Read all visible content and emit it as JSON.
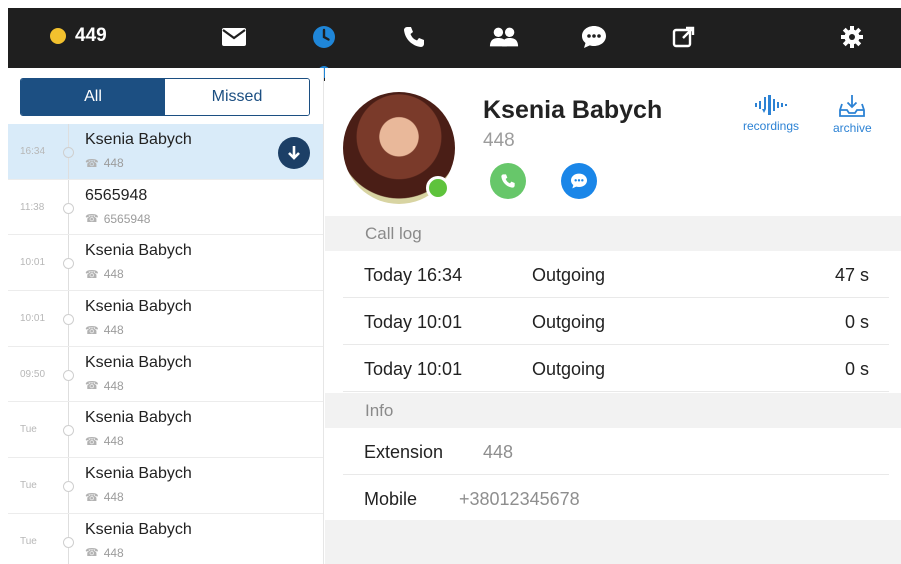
{
  "topbar": {
    "status_count": "449",
    "status_color": "#f2c12e",
    "icons": [
      "envelope-icon",
      "clock-icon",
      "phone-icon",
      "users-icon",
      "chat-icon",
      "external-link-icon",
      "gear-icon"
    ],
    "active_tab": "clock-icon"
  },
  "filter": {
    "all_label": "All",
    "missed_label": "Missed",
    "selected": "All"
  },
  "calls": [
    {
      "time": "16:34",
      "name": "Ksenia Babych",
      "number": "448",
      "selected": true
    },
    {
      "time": "11:38",
      "name": "6565948",
      "number": "6565948",
      "selected": false
    },
    {
      "time": "10:01",
      "name": "Ksenia Babych",
      "number": "448",
      "selected": false
    },
    {
      "time": "10:01",
      "name": "Ksenia Babych",
      "number": "448",
      "selected": false
    },
    {
      "time": "09:50",
      "name": "Ksenia Babych",
      "number": "448",
      "selected": false
    },
    {
      "time": "Tue",
      "name": "Ksenia Babych",
      "number": "448",
      "selected": false
    },
    {
      "time": "Tue",
      "name": "Ksenia Babych",
      "number": "448",
      "selected": false
    },
    {
      "time": "Tue",
      "name": "Ksenia Babych",
      "number": "448",
      "selected": false
    }
  ],
  "contact": {
    "name": "Ksenia Babych",
    "extension": "448",
    "presence": "online",
    "recordings_label": "recordings",
    "archive_label": "archive"
  },
  "call_log": {
    "header": "Call log",
    "entries": [
      {
        "when": "Today 16:34",
        "direction": "Outgoing",
        "duration": "47 s"
      },
      {
        "when": "Today 10:01",
        "direction": "Outgoing",
        "duration": "0 s"
      },
      {
        "when": "Today 10:01",
        "direction": "Outgoing",
        "duration": "0 s"
      }
    ]
  },
  "info": {
    "header": "Info",
    "extension_label": "Extension",
    "extension_value": "448",
    "mobile_label": "Mobile",
    "mobile_value": "+38012345678"
  },
  "colors": {
    "accent": "#1c4f82",
    "active_blue": "#1f86d8",
    "call_green": "#67c76a",
    "chat_blue": "#1a86e8",
    "online_green": "#5ec33c"
  }
}
